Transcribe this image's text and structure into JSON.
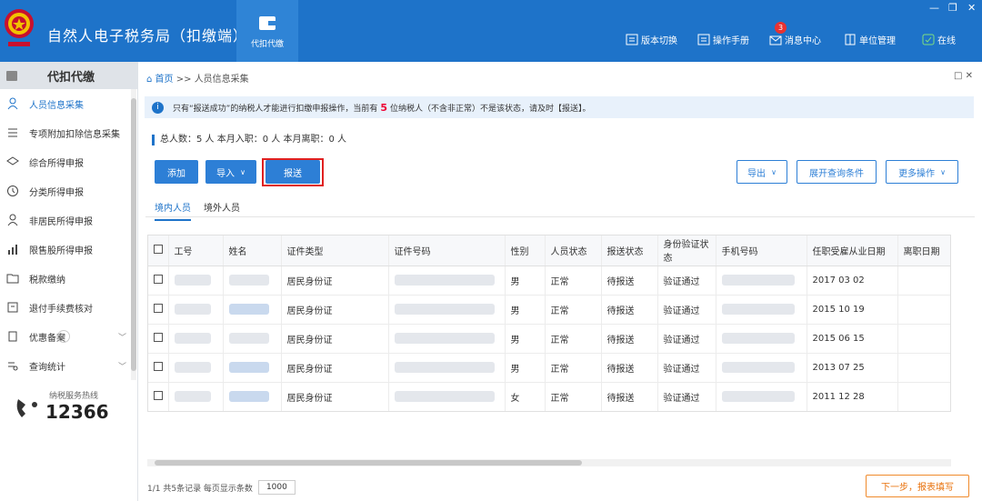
{
  "app": {
    "title": "自然人电子税务局（扣缴端）",
    "module": "代扣代缴"
  },
  "top_actions": [
    {
      "label": "版本切换"
    },
    {
      "label": "操作手册"
    },
    {
      "label": "消息中心",
      "badge": "3"
    },
    {
      "label": "单位管理"
    },
    {
      "label": "在线"
    }
  ],
  "window_controls": {
    "minimize": "—",
    "restore": "❐",
    "close": "✕"
  },
  "sidebar": {
    "header": "代扣代缴",
    "items": [
      {
        "label": "人员信息采集"
      },
      {
        "label": "专项附加扣除信息采集"
      },
      {
        "label": "综合所得申报"
      },
      {
        "label": "分类所得申报"
      },
      {
        "label": "非居民所得申报"
      },
      {
        "label": "限售股所得申报"
      },
      {
        "label": "税款缴纳"
      },
      {
        "label": "退付手续费核对"
      },
      {
        "label": "优惠备案"
      },
      {
        "label": "查询统计"
      }
    ],
    "collapse": "«",
    "hotline_label": "纳税服务热线",
    "hotline_number": "12366"
  },
  "main": {
    "breadcrumb_home": "首页",
    "breadcrumb_sep": ">>",
    "breadcrumb_current": "人员信息采集",
    "page_ctl": "□ ✕",
    "notice_pre": "只有“报送成功”的纳税人才能进行扣缴申报操作，当前有",
    "notice_count": "5",
    "notice_post": "位纳税人（不含非正常）不是该状态，请及时【报送】。",
    "stats": "总人数：5 人   本月入职：0 人   本月离职：0 人",
    "buttons": {
      "add": "添加",
      "import": "导入",
      "submit": "报送",
      "export": "导出",
      "expand": "展开查询条件",
      "more": "更多操作"
    },
    "tabs": [
      "境内人员",
      "境外人员"
    ],
    "columns": [
      "工号",
      "姓名",
      "证件类型",
      "证件号码",
      "性别",
      "人员状态",
      "报送状态",
      "身份验证状态",
      "手机号码",
      "任职受雇从业日期",
      "离职日期"
    ],
    "rows": [
      {
        "id_type": "居民身份证",
        "gender": "男",
        "status": "正常",
        "report": "待报送",
        "verify": "验证通过",
        "date": "2017 03 02"
      },
      {
        "id_type": "居民身份证",
        "gender": "男",
        "status": "正常",
        "report": "待报送",
        "verify": "验证通过",
        "date": "2015 10 19"
      },
      {
        "id_type": "居民身份证",
        "gender": "男",
        "status": "正常",
        "report": "待报送",
        "verify": "验证通过",
        "date": "2015 06 15"
      },
      {
        "id_type": "居民身份证",
        "gender": "男",
        "status": "正常",
        "report": "待报送",
        "verify": "验证通过",
        "date": "2013 07 25"
      },
      {
        "id_type": "居民身份证",
        "gender": "女",
        "status": "正常",
        "report": "待报送",
        "verify": "验证通过",
        "date": "2011 12 28"
      }
    ],
    "pager": "1/1 共5条记录 每页显示条数",
    "page_size": "1000",
    "next": "下一步，报表填写"
  },
  "colors": {
    "brand": "#1e73c9",
    "highlight_border": "#e02020",
    "next_button": "#f08a2c"
  }
}
